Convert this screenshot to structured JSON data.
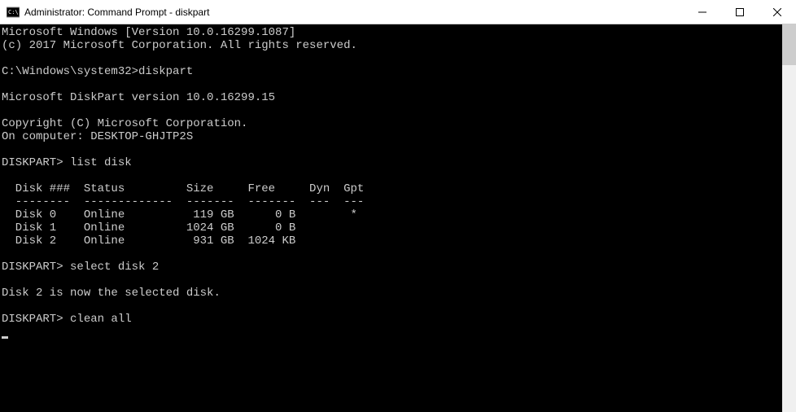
{
  "titlebar": {
    "title": "Administrator: Command Prompt - diskpart"
  },
  "terminal": {
    "line1": "Microsoft Windows [Version 10.0.16299.1087]",
    "line2": "(c) 2017 Microsoft Corporation. All rights reserved.",
    "prompt1": "C:\\Windows\\system32>",
    "cmd1": "diskpart",
    "dp_version": "Microsoft DiskPart version 10.0.16299.15",
    "dp_copyright": "Copyright (C) Microsoft Corporation.",
    "dp_computer": "On computer: DESKTOP-GHJTP2S",
    "dp_prompt": "DISKPART>",
    "cmd_list": " list disk",
    "table_header": "  Disk ###  Status         Size     Free     Dyn  Gpt",
    "table_divider": "  --------  -------------  -------  -------  ---  ---",
    "table_row0": "  Disk 0    Online          119 GB      0 B        *",
    "table_row1": "  Disk 1    Online         1024 GB      0 B",
    "table_row2": "  Disk 2    Online          931 GB  1024 KB",
    "cmd_select": " select disk 2",
    "msg_selected": "Disk 2 is now the selected disk.",
    "cmd_clean": " clean all"
  },
  "disks": [
    {
      "num": "Disk 0",
      "status": "Online",
      "size": "119 GB",
      "free": "0 B",
      "dyn": "",
      "gpt": "*"
    },
    {
      "num": "Disk 1",
      "status": "Online",
      "size": "1024 GB",
      "free": "0 B",
      "dyn": "",
      "gpt": ""
    },
    {
      "num": "Disk 2",
      "status": "Online",
      "size": "931 GB",
      "free": "1024 KB",
      "dyn": "",
      "gpt": ""
    }
  ]
}
